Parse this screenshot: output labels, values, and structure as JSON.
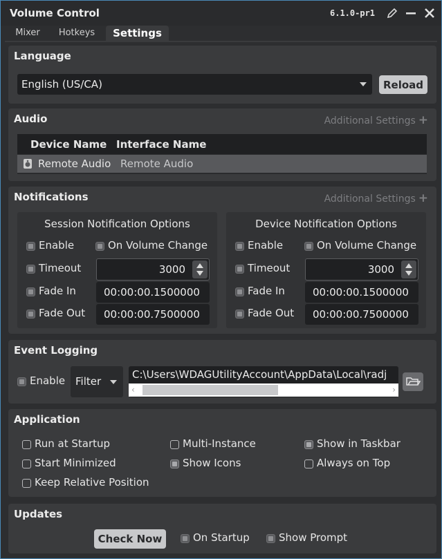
{
  "window": {
    "title": "Volume Control",
    "version": "6.1.0-pr1"
  },
  "tabs": [
    {
      "label": "Mixer"
    },
    {
      "label": "Hotkeys"
    },
    {
      "label": "Settings"
    }
  ],
  "language": {
    "title": "Language",
    "selected": "English (US/CA)",
    "reload_label": "Reload"
  },
  "audio": {
    "title": "Audio",
    "additional_settings": "Additional Settings",
    "columns": [
      "Device Name",
      "Interface Name"
    ],
    "rows": [
      {
        "device": "Remote Audio",
        "interface": "Remote Audio"
      }
    ]
  },
  "notifications": {
    "title": "Notifications",
    "additional_settings": "Additional Settings",
    "session": {
      "title": "Session Notification Options",
      "enable_label": "Enable",
      "on_volume_change_label": "On Volume Change",
      "timeout_label": "Timeout",
      "timeout_value": "3000",
      "fade_in_label": "Fade In",
      "fade_in_value": "00:00:00.1500000",
      "fade_out_label": "Fade Out",
      "fade_out_value": "00:00:00.7500000"
    },
    "device": {
      "title": "Device Notification Options",
      "enable_label": "Enable",
      "on_volume_change_label": "On Volume Change",
      "timeout_label": "Timeout",
      "timeout_value": "3000",
      "fade_in_label": "Fade In",
      "fade_in_value": "00:00:00.1500000",
      "fade_out_label": "Fade Out",
      "fade_out_value": "00:00:00.7500000"
    }
  },
  "event_logging": {
    "title": "Event Logging",
    "enable_label": "Enable",
    "filter_label": "Filter",
    "path": "C:\\Users\\WDAGUtilityAccount\\AppData\\Local\\radj"
  },
  "application": {
    "title": "Application",
    "options": {
      "run_at_startup": "Run at Startup",
      "multi_instance": "Multi-Instance",
      "show_in_taskbar": "Show in Taskbar",
      "start_minimized": "Start Minimized",
      "show_icons": "Show Icons",
      "always_on_top": "Always on Top",
      "keep_relative_position": "Keep Relative Position"
    }
  },
  "updates": {
    "title": "Updates",
    "check_now_label": "Check Now",
    "on_startup_label": "On Startup",
    "show_prompt_label": "Show Prompt"
  },
  "colors": {
    "accent_border": "#4a8ab8",
    "panel_bg": "#3a3b3d",
    "field_bg": "#1f2022"
  }
}
